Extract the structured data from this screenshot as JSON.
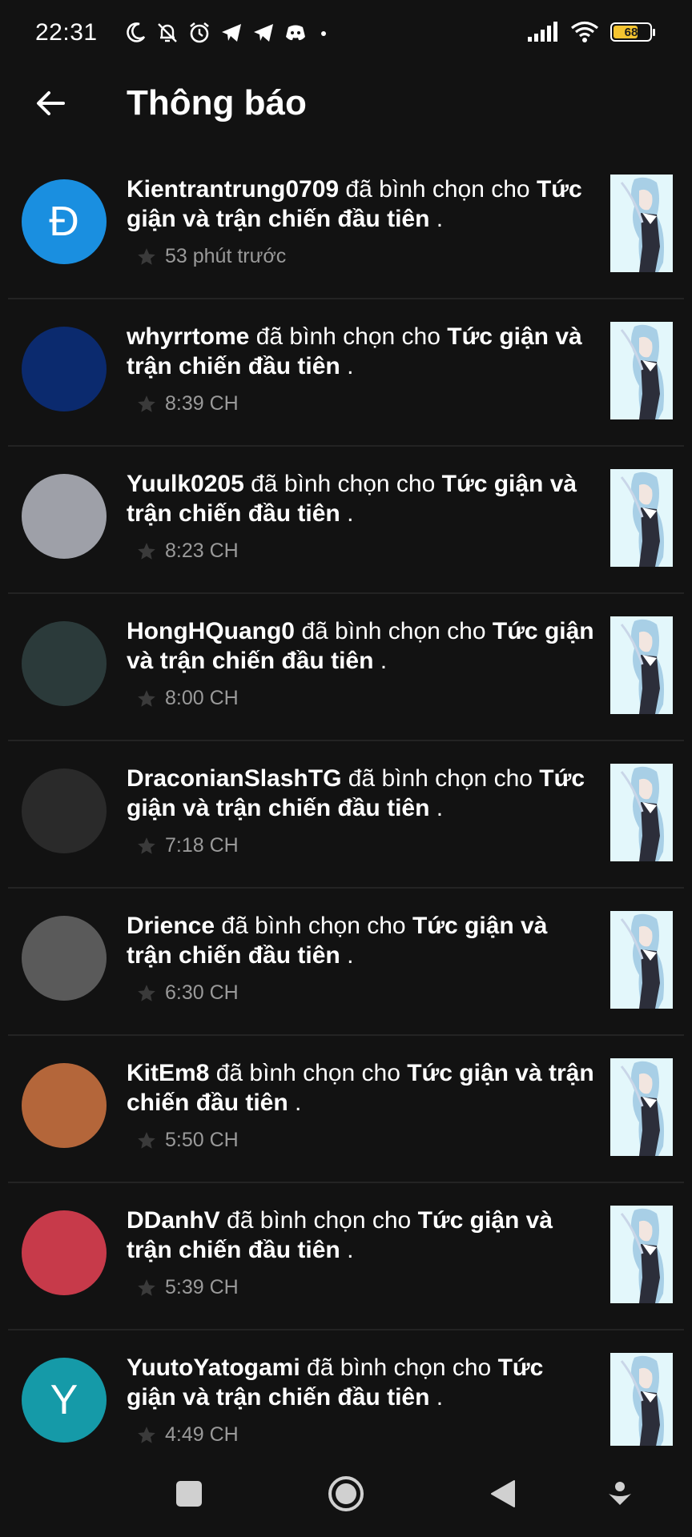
{
  "status_bar": {
    "time": "22:31",
    "battery": "68",
    "icons_left": [
      "moon-icon",
      "bell-off-icon",
      "alarm-icon",
      "telegram-icon",
      "telegram-icon",
      "discord-icon",
      "dot-icon"
    ],
    "icons_right": [
      "signal-icon",
      "wifi-icon",
      "battery-icon"
    ]
  },
  "header": {
    "title": "Thông báo",
    "back_icon": "arrow-left-icon"
  },
  "notifications": [
    {
      "user": "Kientrantrung0709",
      "action": "đã bình chọn cho",
      "work": "Tức giận và trận chiến đầu tiên",
      "end": ".",
      "time": "53 phút trước",
      "avatar_letter": "Đ",
      "avatar_color": "#1a8fe0"
    },
    {
      "user": "whyrrtome",
      "action": "đã bình chọn cho",
      "work": "Tức giận và trận chiến đầu tiên",
      "end": ".",
      "time": "8:39 CH",
      "avatar_letter": "",
      "avatar_color": "#0b2a6e"
    },
    {
      "user": "Yuulk0205",
      "action": "đã bình chọn cho",
      "work": "Tức giận và trận chiến đầu tiên",
      "end": ".",
      "time": "8:23 CH",
      "avatar_letter": "",
      "avatar_color": "#9ea0a8"
    },
    {
      "user": "HongHQuang0",
      "action": "đã bình chọn cho",
      "work": "Tức giận và trận chiến đầu tiên",
      "end": ".",
      "time": "8:00 CH",
      "avatar_letter": "",
      "avatar_color": "#2b3a3a"
    },
    {
      "user": "DraconianSlashTG",
      "action": "đã bình chọn cho",
      "work": "Tức giận và trận chiến đầu tiên",
      "end": ".",
      "time": "7:18 CH",
      "avatar_letter": "",
      "avatar_color": "#2a2a2a"
    },
    {
      "user": "Drience",
      "action": "đã bình chọn cho",
      "work": "Tức giận và trận chiến đầu tiên",
      "end": ".",
      "time": "6:30 CH",
      "avatar_letter": "",
      "avatar_color": "#5a5a5a"
    },
    {
      "user": "KitEm8",
      "action": "đã bình chọn cho",
      "work": "Tức giận và trận chiến đầu tiên",
      "end": ".",
      "time": "5:50 CH",
      "avatar_letter": "",
      "avatar_color": "#b4663a"
    },
    {
      "user": "DDanhV",
      "action": "đã bình chọn cho",
      "work": "Tức giận và trận chiến đầu tiên",
      "end": ".",
      "time": "5:39 CH",
      "avatar_letter": "",
      "avatar_color": "#c73a4a"
    },
    {
      "user": "YuutoYatogami",
      "action": "đã bình chọn cho",
      "work": "Tức giận và trận chiến đầu tiên",
      "end": ".",
      "time": "4:49 CH",
      "avatar_letter": "Y",
      "avatar_color": "#159aa8"
    }
  ],
  "nav_bar": {
    "buttons": [
      "recents-button",
      "home-button",
      "back-button",
      "assistant-button"
    ]
  }
}
